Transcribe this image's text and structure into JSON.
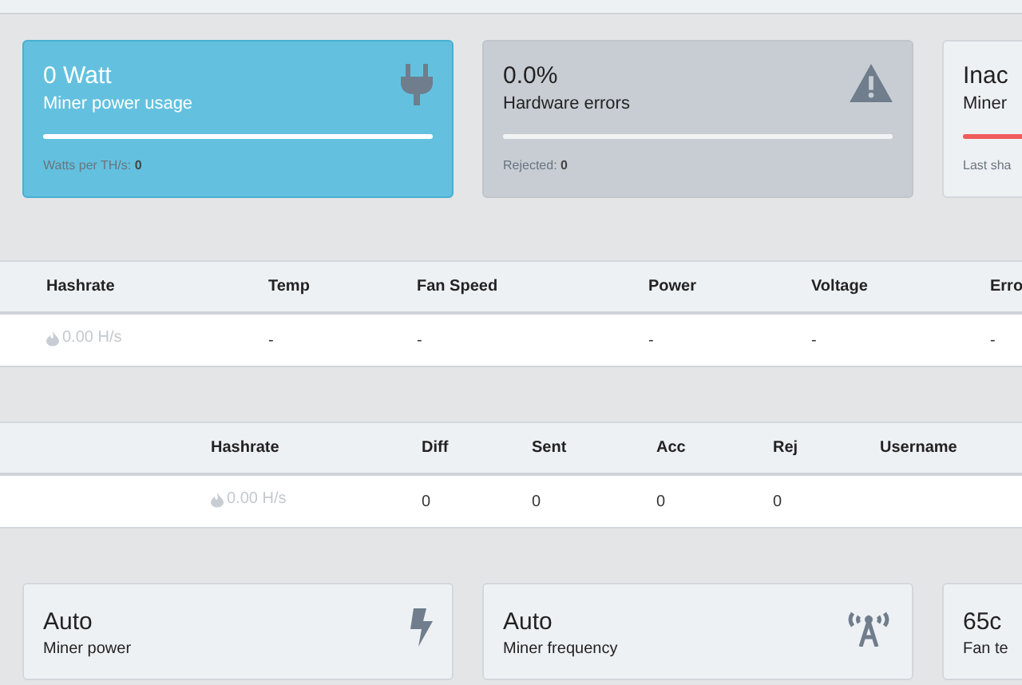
{
  "stat_cards": [
    {
      "kind": "info",
      "value": "0 Watt",
      "label": "Miner power usage",
      "level": 1,
      "footer": "Watts per TH/s: **0**"
    },
    {
      "kind": "muted",
      "value": "0.0%",
      "label": "Hardware errors",
      "level": 1,
      "footer": "Rejected: **0**"
    },
    {
      "kind": "plain",
      "value": "Inac",
      "label": "Miner",
      "level": 1,
      "footer": "Last sha"
    }
  ],
  "boards_table": {
    "columns": [
      "Hashrate",
      "Temp",
      "Fan Speed",
      "Power",
      "Voltage",
      "Erro"
    ],
    "rows": [
      [
        "0.00 H/s",
        "-",
        "-",
        "-",
        "-",
        "-"
      ]
    ]
  },
  "pools_table": {
    "columns": [
      "",
      "Hashrate",
      "Diff",
      "Sent",
      "Acc",
      "Rej",
      "Username"
    ],
    "rows": [
      [
        "",
        "0.00 H/s",
        "0",
        "0",
        "0",
        "0",
        ""
      ]
    ]
  },
  "setting_cards": [
    {
      "value": "Auto",
      "label": "Miner power"
    },
    {
      "value": "Auto",
      "label": "Miner frequency"
    },
    {
      "value": "65c",
      "label": "Fan te"
    }
  ]
}
